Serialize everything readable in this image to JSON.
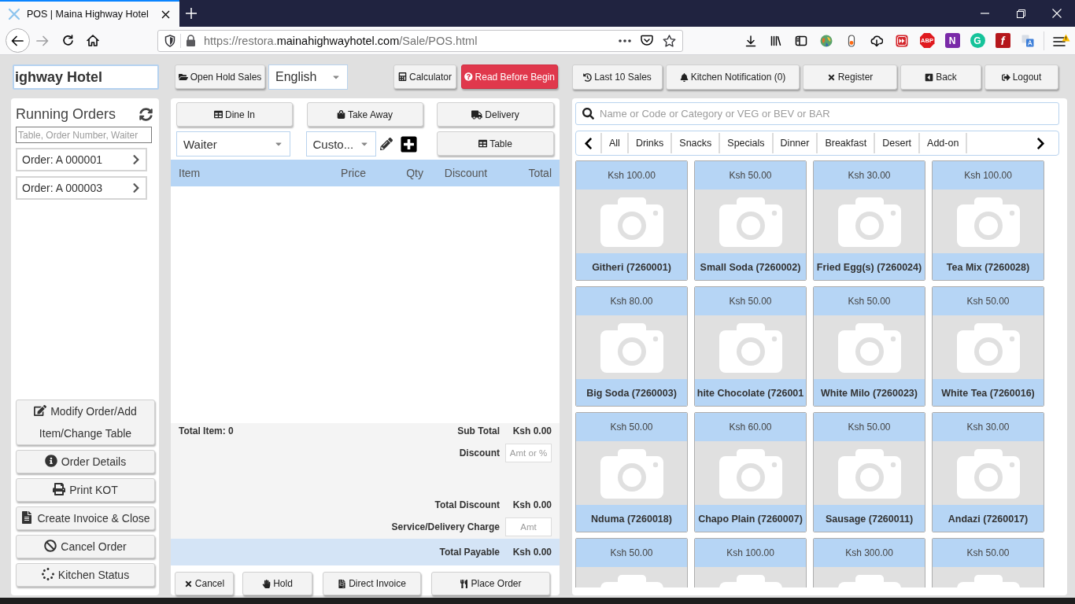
{
  "browser": {
    "tab_title": "POS | Maina Highway Hotel",
    "url": {
      "prefix": "https://restora.",
      "domain": "mainahighwayhotel.com",
      "path": "/Sale/POS.html"
    },
    "extension_labels": [
      "ABP",
      "N",
      "G",
      "f"
    ]
  },
  "top_bar": {
    "store_name": "ighway Hotel",
    "hold_sales_button": "Open Hold Sales",
    "language_select": "English",
    "tools": [
      {
        "label": "Calculator",
        "kind": "plain"
      },
      {
        "label": "Read Before Begin",
        "kind": "alert"
      }
    ],
    "nav_buttons": [
      "Last 10 Sales",
      "Kitchen Notification (0)",
      "Register",
      "Back",
      "Logout"
    ]
  },
  "running_orders": {
    "title": "Running Orders",
    "search": {
      "placeholder": "Table, Order Number, Waiter"
    },
    "orders": [
      "Order: A 000001",
      "Order: A 000003"
    ],
    "actions": [
      "Modify Order/Add Item/Change Table",
      "Order Details",
      "Print KOT",
      "Create Invoice & Close",
      "Cancel Order",
      "Kitchen Status"
    ]
  },
  "order": {
    "order_types": [
      "Dine In",
      "Take Away",
      "Delivery"
    ],
    "waiter_select": "Waiter",
    "customer_select": "Custo...",
    "table_button": "Table",
    "columns": [
      "Item",
      "Price",
      "Qty",
      "Discount",
      "Total"
    ],
    "total_items": "Total Item: 0",
    "sub_total": {
      "label": "Sub Total",
      "value": "Ksh 0.00"
    },
    "discount": {
      "label": "Discount",
      "placeholder": "Amt or %"
    },
    "total_discount": {
      "label": "Total Discount",
      "value": "Ksh 0.00"
    },
    "service_charge": {
      "label": "Service/Delivery Charge",
      "placeholder": "Amt"
    },
    "total_payable": {
      "label": "Total Payable",
      "value": "Ksh 0.00"
    },
    "actions": [
      "Cancel",
      "Hold",
      "Direct Invoice",
      "Place Order"
    ]
  },
  "menu": {
    "search": {
      "placeholder": "Name or Code or Category or VEG or BEV or BAR"
    },
    "categories": [
      "All",
      "Drinks",
      "Snacks",
      "Specials",
      "Dinner",
      "Breakfast",
      "Desert",
      "Add-on"
    ],
    "products": [
      {
        "price": "Ksh 100.00",
        "name": "Githeri (7260001)"
      },
      {
        "price": "Ksh 50.00",
        "name": "Small Soda (7260002)"
      },
      {
        "price": "Ksh 30.00",
        "name": "Fried Egg(s) (7260024)"
      },
      {
        "price": "Ksh 100.00",
        "name": "Tea Mix (7260028)"
      },
      {
        "price": "Ksh 80.00",
        "name": "Big Soda (7260003)"
      },
      {
        "price": "Ksh 50.00",
        "name": "hite Chocolate (726001"
      },
      {
        "price": "Ksh 50.00",
        "name": "White Milo (7260023)"
      },
      {
        "price": "Ksh 50.00",
        "name": "White Tea (7260016)"
      },
      {
        "price": "Ksh 50.00",
        "name": "Nduma (7260018)"
      },
      {
        "price": "Ksh 60.00",
        "name": "Chapo Plain (7260007)"
      },
      {
        "price": "Ksh 50.00",
        "name": "Sausage (7260011)"
      },
      {
        "price": "Ksh 30.00",
        "name": "Andazi (7260017)"
      },
      {
        "price": "Ksh 50.00"
      },
      {
        "price": "Ksh 100.00"
      },
      {
        "price": "Ksh 300.00"
      },
      {
        "price": "Ksh 50.00"
      }
    ]
  }
}
